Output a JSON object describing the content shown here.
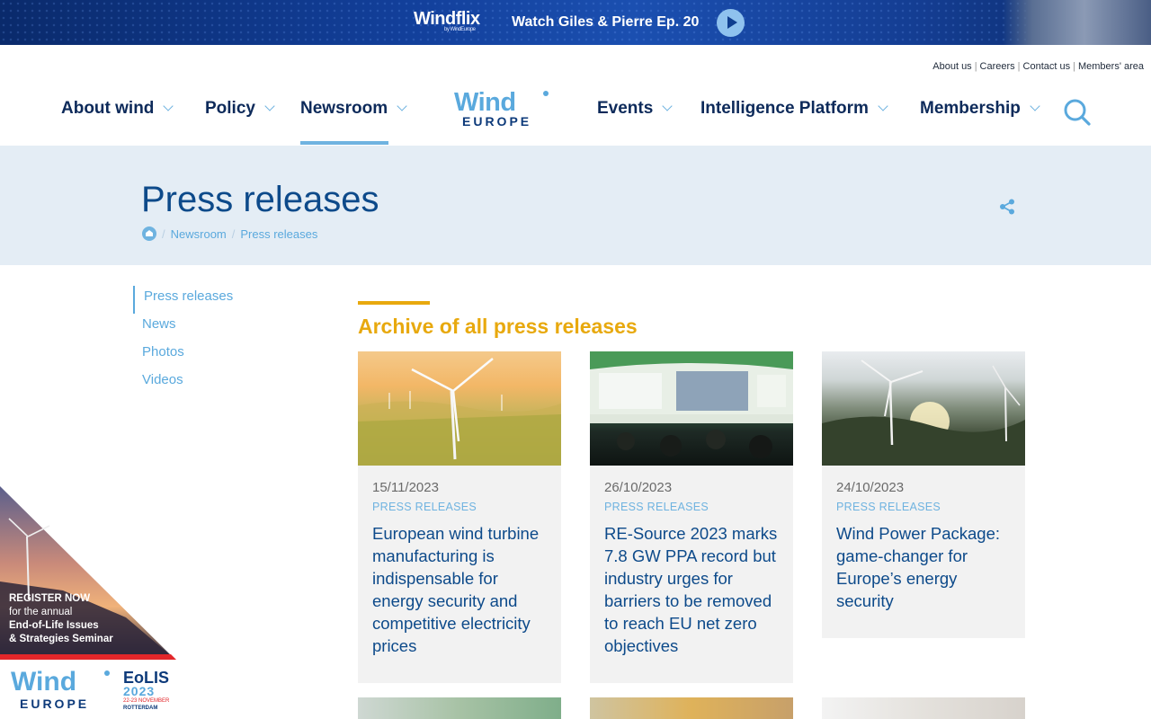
{
  "banner": {
    "logo": "Windflix",
    "logo_sub": "by WindEurope",
    "watch_text": "Watch Giles & Pierre Ep. 20",
    "play_icon": "play-icon"
  },
  "toplinks": [
    "About us",
    "Careers",
    "Contact us",
    "Members' area"
  ],
  "nav": {
    "left": [
      "About wind",
      "Policy",
      "Newsroom"
    ],
    "right": [
      "Events",
      "Intelligence Platform",
      "Membership"
    ],
    "active": "Newsroom"
  },
  "logo": {
    "wind": "Wind",
    "europe": "EUROPE"
  },
  "page": {
    "title": "Press releases",
    "breadcrumb": [
      "Newsroom",
      "Press releases"
    ]
  },
  "sidebar": [
    "Press releases",
    "News",
    "Photos",
    "Videos"
  ],
  "section": {
    "title": "Archive of all press releases"
  },
  "cards": [
    {
      "date": "15/11/2023",
      "category": "PRESS RELEASES",
      "title": "European wind turbine manufacturing is indispensable for energy security and competitive electricity prices"
    },
    {
      "date": "26/10/2023",
      "category": "PRESS RELEASES",
      "title": "RE-Source 2023 marks 7.8 GW PPA record but industry urges for barriers to be removed to reach EU net zero objectives"
    },
    {
      "date": "24/10/2023",
      "category": "PRESS RELEASES",
      "title": "Wind Power Package: game-changer for Europe’s energy security"
    }
  ],
  "promo": {
    "line1": "REGISTER NOW",
    "line2": "for the annual",
    "line3": "End-of-Life Issues",
    "line4": "& Strategies Seminar",
    "brand": "Wind",
    "brand_sub": "EUROPE",
    "event": "EoLIS",
    "year": "2023",
    "dates": "22-23 NOVEMBER",
    "city": "ROTTERDAM"
  },
  "colors": {
    "accent": "#5aa9dd",
    "navy": "#0d4a8a",
    "gold": "#e8a90e",
    "band": "#e4edf5"
  }
}
